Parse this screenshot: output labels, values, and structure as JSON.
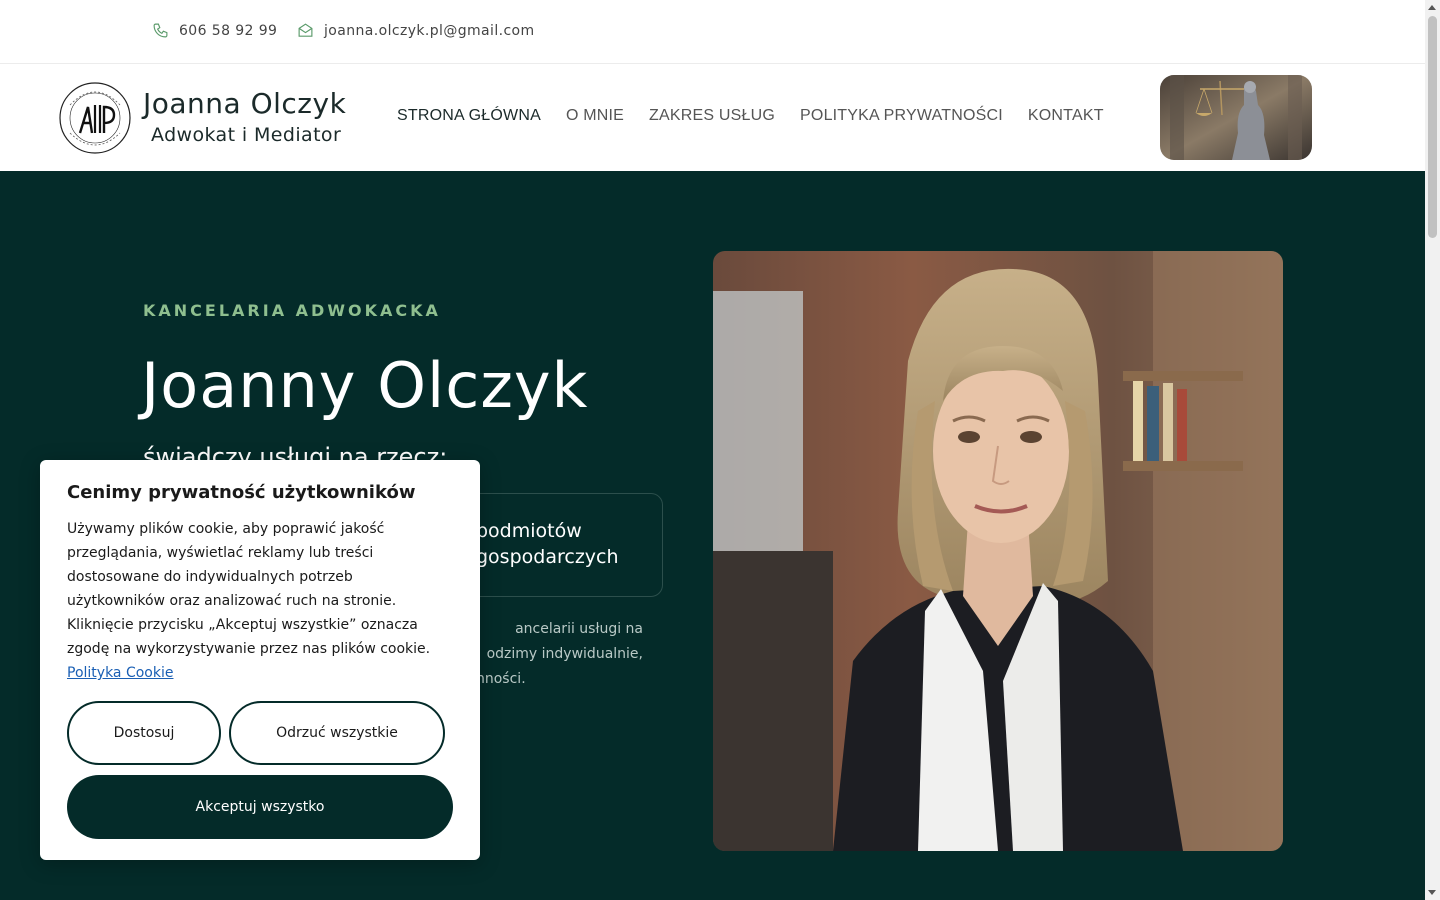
{
  "topbar": {
    "phone": "606 58 92 99",
    "email": "joanna.olczyk.pl@gmail.com"
  },
  "header": {
    "brand_name": "Joanna Olczyk",
    "brand_subtitle": "Adwokat i Mediator",
    "nav": [
      {
        "label": "STRONA GŁÓWNA",
        "active": true
      },
      {
        "label": "O MNIE"
      },
      {
        "label": "ZAKRES USŁUG"
      },
      {
        "label": "POLITYKA PRYWATNOŚCI"
      },
      {
        "label": "KONTAKT"
      }
    ]
  },
  "hero": {
    "eyebrow": "KANCELARIA ADWOKACKA",
    "title": "Joanny Olczyk",
    "subtitle": "świadczy usługi na rzecz:",
    "client_line1": "podmiotów",
    "client_line2": "gospodarczych",
    "desc_line1": "ancelarii usługi na",
    "desc_line2": "odzimy indywidualnie,",
    "desc_line3": "nności."
  },
  "cookie": {
    "title": "Cenimy prywatność użytkowników",
    "text": "Używamy plików cookie, aby poprawić jakość przeglądania, wyświetlać reklamy lub treści dostosowane do indywidualnych potrzeb użytkowników oraz analizować ruch na stronie. Kliknięcie przycisku „Akceptuj wszystkie” oznacza zgodę na wykorzystywanie przez nas plików cookie.",
    "link": "Polityka Cookie",
    "customize": "Dostosuj",
    "reject": "Odrzuć wszystkie",
    "accept": "Akceptuj wszystko"
  },
  "colors": {
    "hero_bg": "#042b29",
    "accent_green": "#8fbf8f",
    "icon_green": "#5a9a6a"
  }
}
